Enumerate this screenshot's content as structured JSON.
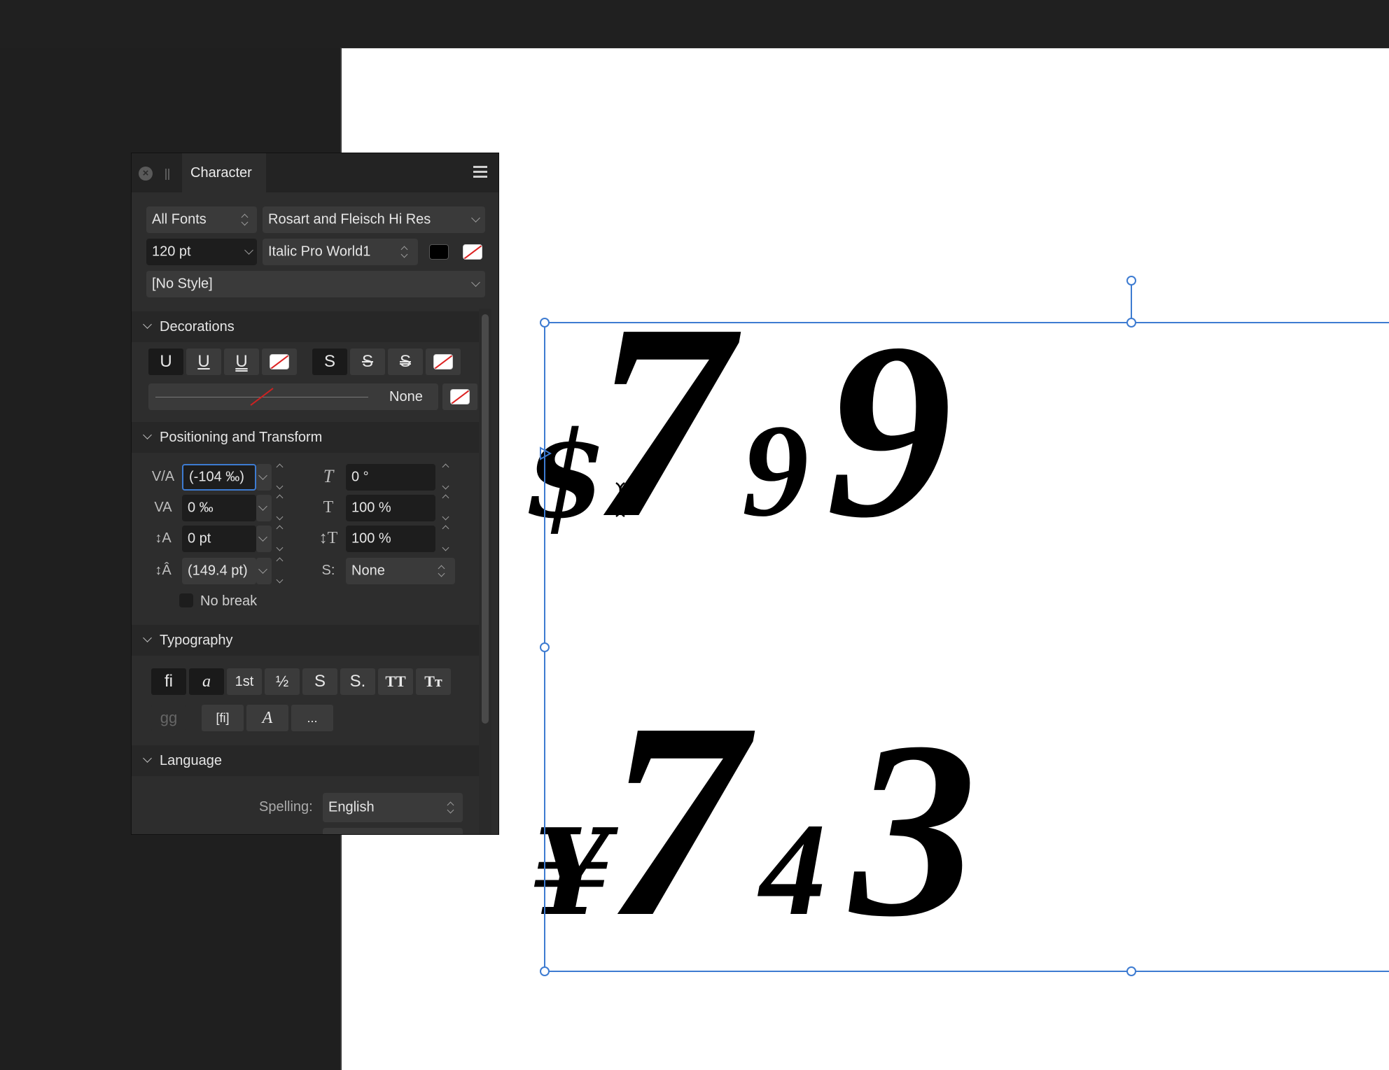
{
  "panel": {
    "title": "Character",
    "font_collection": "All Fonts",
    "font_family": "Rosart and Fleisch Hi Res",
    "font_size": "120 pt",
    "font_style": "Italic Pro World1",
    "paragraph_style": "[No Style]"
  },
  "decorations": {
    "header": "Decorations",
    "underline_btns": [
      "U",
      "U",
      "U"
    ],
    "strike_btns": [
      "S",
      "S",
      "S"
    ],
    "line_style_value": "None"
  },
  "positioning": {
    "header": "Positioning and Transform",
    "kerning": "(-104 ‰)",
    "tracking": "0 ‰",
    "baseline_shift": "0 pt",
    "leading": "(149.4 pt)",
    "skew": "0 °",
    "horizontal_scale": "100 %",
    "vertical_scale": "100 %",
    "position": "None",
    "no_break_label": "No break"
  },
  "typography": {
    "header": "Typography",
    "row1": [
      "fi",
      "a",
      "1st",
      "½",
      "S",
      "S.",
      "TT",
      "Tт"
    ],
    "more_label": "..."
  },
  "language": {
    "header": "Language",
    "spelling_label": "Spelling:",
    "spelling_value": "English"
  },
  "canvas": {
    "line1": [
      "$",
      "7",
      "9",
      "9"
    ],
    "line2": [
      "¥",
      "7",
      "4",
      "3"
    ]
  },
  "colors": {
    "panel_bg": "#2d2d2d",
    "selection_blue": "#3d7bd1",
    "fill_color": "#000000"
  }
}
